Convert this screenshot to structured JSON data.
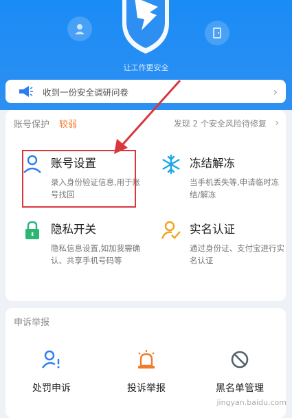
{
  "hero": {
    "tagline": "让工作更安全",
    "accent": "#1a8cf5",
    "left_icon": "person-icon",
    "right_icon": "door-icon",
    "shield_icon": "dingtalk-shield-icon"
  },
  "survey": {
    "text": "收到一份安全调研问卷",
    "icon": "megaphone-icon"
  },
  "account_protection": {
    "title": "账号保护",
    "strength": "较弱",
    "risk_text": "发现 2 个安全风险待修复",
    "features": [
      {
        "name": "账号设置",
        "desc": "录入身份验证信息,用于账号找回",
        "icon": "person-icon",
        "color": "#2b7ef0"
      },
      {
        "name": "冻结解冻",
        "desc": "当手机丢失等,申请临时冻结/解冻",
        "icon": "snowflake-icon",
        "color": "#1aa6e8"
      },
      {
        "name": "隐私开关",
        "desc": "隐私信息设置,如加我需确认、共享手机号码等",
        "icon": "lock-icon",
        "color": "#2bb673"
      },
      {
        "name": "实名认证",
        "desc": "通过身份证、支付宝进行实名认证",
        "icon": "person-check-icon",
        "color": "#f2a31a"
      }
    ]
  },
  "complaint": {
    "title": "申诉举报",
    "options": [
      {
        "name": "处罚申诉",
        "icon": "person-alert-icon",
        "color": "#2b7ef0"
      },
      {
        "name": "投诉举报",
        "icon": "siren-icon",
        "color": "#f07b2c"
      },
      {
        "name": "黑名单管理",
        "icon": "block-icon",
        "color": "#55606e"
      }
    ]
  },
  "watermark": "jingyan.baidu.com"
}
